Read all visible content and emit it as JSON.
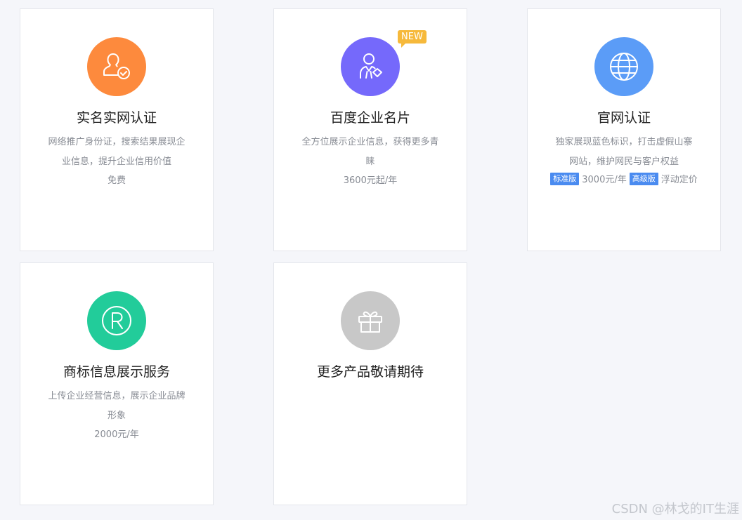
{
  "colors": {
    "orange": "#fd8a3d",
    "purple": "#7569fb",
    "blue": "#5b9cf7",
    "green": "#22cc9a",
    "gray": "#c8c8c8",
    "badge_new": "#f6b93b",
    "tier_tag": "#4a8bf0"
  },
  "cards": [
    {
      "title": "实名实网认证",
      "desc": "网络推广身份证，搜索结果展现企业信息，提升企业信用价值",
      "price": "免费",
      "icon": "user-check-icon"
    },
    {
      "title": "百度企业名片",
      "desc": "全方位展示企业信息，获得更多青睐",
      "price": "3600元起/年",
      "badge": "NEW",
      "icon": "user-card-icon"
    },
    {
      "title": "官网认证",
      "desc": "独家展现蓝色标识，打击虚假山寨网站，维护网民与客户权益",
      "tiers": [
        {
          "tag": "标准版",
          "price": "3000元/年"
        },
        {
          "tag": "高级版",
          "price": "浮动定价"
        }
      ],
      "icon": "globe-icon"
    },
    {
      "title": "商标信息展示服务",
      "desc": "上传企业经营信息，展示企业品牌形象",
      "price": "2000元/年",
      "icon": "registered-trademark-icon"
    },
    {
      "title": "更多产品敬请期待",
      "icon": "gift-icon"
    }
  ],
  "watermark": "CSDN @林戈的IT生涯"
}
